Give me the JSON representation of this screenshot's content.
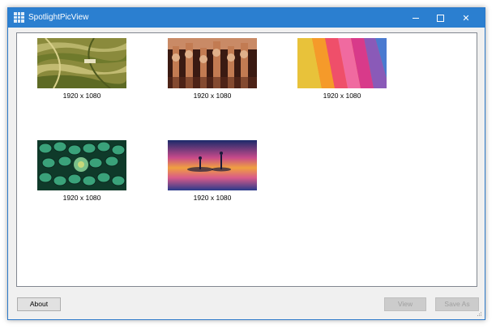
{
  "window": {
    "title": "SpotlightPicView"
  },
  "titlebar_buttons": {
    "minimize_icon": "minimize-icon",
    "maximize_icon": "maximize-icon",
    "close_icon": "close-icon",
    "close_glyph": "✕"
  },
  "thumbnails": [
    {
      "caption": "1920 x 1080",
      "subject": "terraced rice fields"
    },
    {
      "caption": "1920 x 1080",
      "subject": "wooden puppets"
    },
    {
      "caption": "1920 x 1080",
      "subject": "colored paper fan"
    },
    {
      "caption": "1920 x 1080",
      "subject": "succulent plant"
    },
    {
      "caption": "1920 x 1080",
      "subject": "water droplet at sunset"
    }
  ],
  "buttons": {
    "about": "About",
    "view": "View",
    "save_as": "Save As"
  },
  "colors": {
    "titlebar": "#2b7fd0",
    "window_border": "#2b79c9",
    "disabled_text": "#a0a0a0"
  }
}
